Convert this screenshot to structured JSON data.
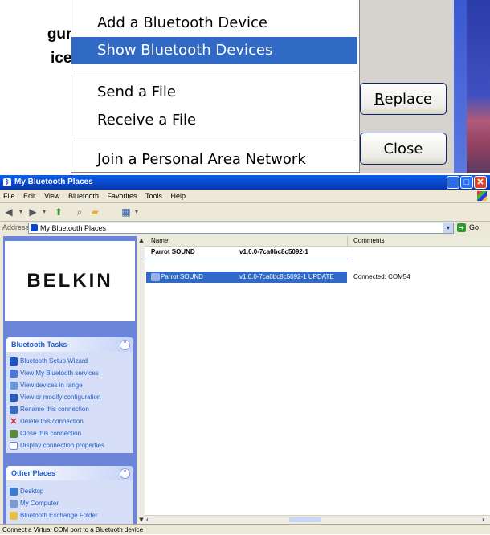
{
  "background_label": {
    "line1": "gure",
    "line2": "ices"
  },
  "context_menu": {
    "items": [
      "Add a Bluetooth Device",
      "Show Bluetooth Devices",
      "Send a File",
      "Receive a File",
      "Join a Personal Area Network"
    ],
    "selected_index": 1
  },
  "dialog_buttons": {
    "replace_prefix": "",
    "replace_underlined": "R",
    "replace_rest": "eplace",
    "close": "Close"
  },
  "window": {
    "title": "My Bluetooth Places",
    "menus": [
      "File",
      "Edit",
      "View",
      "Bluetooth",
      "Favorites",
      "Tools",
      "Help"
    ],
    "address_label": "Address",
    "address_value": "My Bluetooth Places",
    "go_label": "Go"
  },
  "brand": "BELKIN",
  "tasks_panel": {
    "title": "Bluetooth Tasks",
    "items": [
      "Bluetooth Setup Wizard",
      "View My Bluetooth services",
      "View devices in range",
      "View or modify configuration",
      "Rename this connection",
      "Delete this connection",
      "Close this connection",
      "Display connection properties"
    ]
  },
  "places_panel": {
    "title": "Other Places",
    "items": [
      "Desktop",
      "My Computer",
      "Bluetooth Exchange Folder"
    ]
  },
  "list": {
    "columns": [
      "Name",
      "Comments"
    ],
    "group_header": {
      "name": "Parrot SOUND",
      "id": "v1.0.0-7ca0bc8c5092-1"
    },
    "row": {
      "name": "Parrot SOUND",
      "id": "v1.0.0-7ca0bc8c5092-1 UPDATE",
      "comment": "Connected: COM54"
    }
  },
  "status_text": "Connect a Virtual COM port to a Bluetooth device",
  "colors": {
    "accent": "#316ac5",
    "title_bar": "#0a5fe8",
    "task_pane": "#6b85d9",
    "link": "#215dc6"
  }
}
